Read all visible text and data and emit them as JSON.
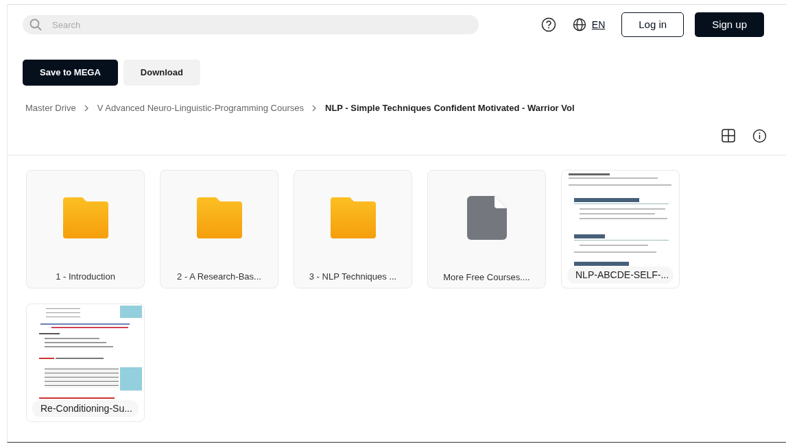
{
  "search": {
    "placeholder": "Search"
  },
  "header": {
    "language": "EN",
    "login": "Log in",
    "signup": "Sign up"
  },
  "actions": {
    "save": "Save to MEGA",
    "download": "Download"
  },
  "breadcrumb": [
    {
      "label": "Master Drive",
      "current": false
    },
    {
      "label": "V Advanced Neuro-Linguistic-Programming Courses",
      "current": false
    },
    {
      "label": "NLP - Simple Techniques Confident Motivated - Warrior Vol",
      "current": true
    }
  ],
  "items": [
    {
      "kind": "folder",
      "name": "1 - Introduction"
    },
    {
      "kind": "folder",
      "name": "2 - A Research-Bas..."
    },
    {
      "kind": "folder",
      "name": "3 - NLP Techniques ..."
    },
    {
      "kind": "file",
      "name": "More Free Courses...."
    },
    {
      "kind": "preview",
      "name": "NLP-ABCDE-SELF-..."
    },
    {
      "kind": "preview",
      "name": "Re-Conditioning-Su..."
    }
  ]
}
